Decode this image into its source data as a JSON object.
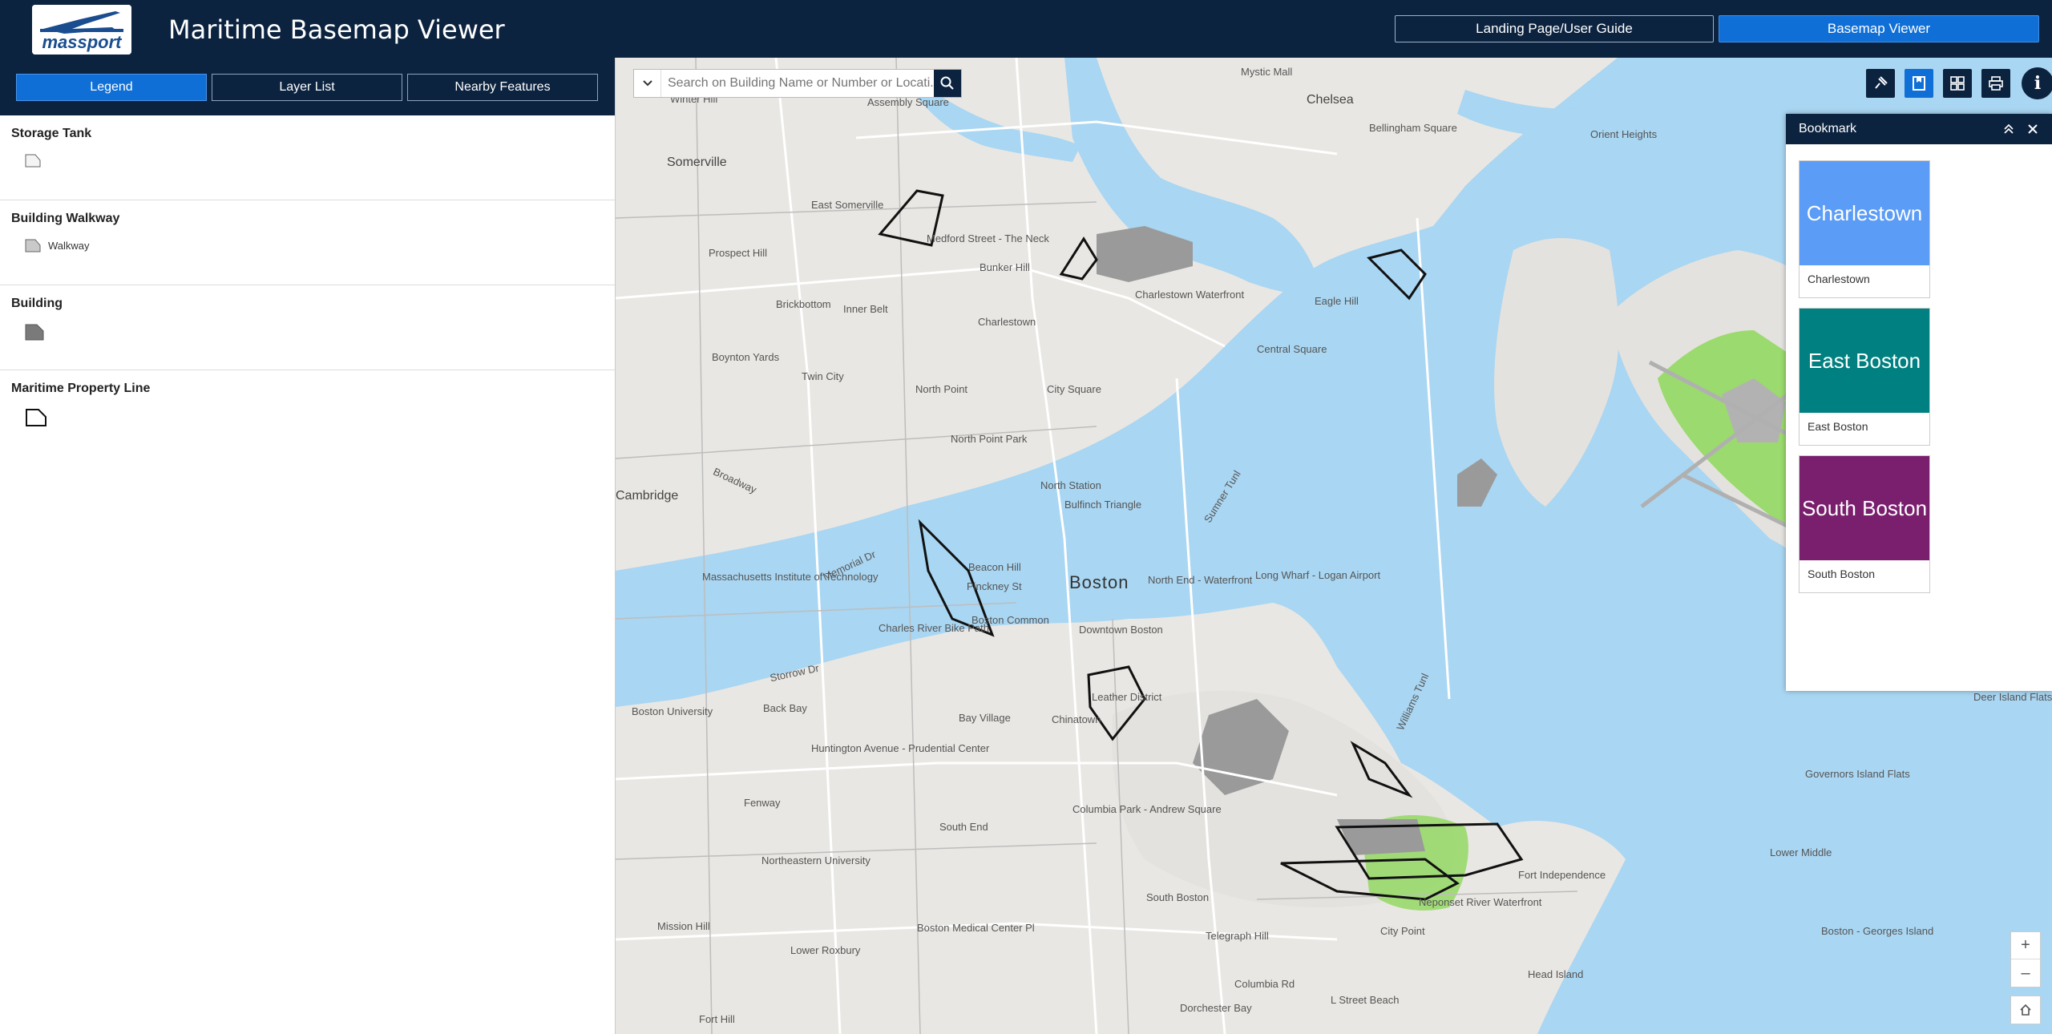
{
  "header": {
    "logo_text": "massport",
    "title": "Maritime Basemap Viewer",
    "buttons": [
      {
        "label": "Landing Page/User Guide"
      },
      {
        "label": "Basemap Viewer"
      }
    ]
  },
  "panel": {
    "tabs": [
      {
        "label": "Legend"
      },
      {
        "label": "Layer List"
      },
      {
        "label": "Nearby Features"
      }
    ],
    "legend": [
      {
        "title": "Storage Tank",
        "items": [
          {
            "label": ""
          }
        ]
      },
      {
        "title": "Building Walkway",
        "items": [
          {
            "label": "Walkway"
          }
        ]
      },
      {
        "title": "Building",
        "items": [
          {
            "label": ""
          }
        ]
      },
      {
        "title": "Maritime Property Line",
        "items": [
          {
            "label": ""
          }
        ]
      }
    ]
  },
  "search": {
    "placeholder": "Search on Building Name or Number or Locati..."
  },
  "bookmark": {
    "title": "Bookmark",
    "items": [
      {
        "thumb_label": "Charlestown",
        "name": "Charlestown",
        "color": "#5b9cf6"
      },
      {
        "thumb_label": "East Boston",
        "name": "East Boston",
        "color": "#008080"
      },
      {
        "thumb_label": "South Boston",
        "name": "South Boston",
        "color": "#7a1f6e"
      }
    ]
  },
  "map": {
    "labels": [
      "Somerville",
      "Chelsea",
      "East Somerville",
      "Prospect Hill",
      "Brickbottom",
      "Inner Belt",
      "Charlestown",
      "Bunker Hill",
      "Medford Street - The Neck",
      "Charlestown Waterfront",
      "Boynton Yards",
      "Twin City",
      "North Point",
      "City Square",
      "North Point Park",
      "Cambridge",
      "Massachusetts Institute of Technology",
      "Beacon Hill",
      "Boston",
      "North Station",
      "Bulfinch Triangle",
      "North End - Waterfront",
      "Boston Common",
      "Downtown Boston",
      "Back Bay",
      "Bay Village",
      "Chinatown",
      "Leather District",
      "Huntington Avenue - Prudential Center",
      "Fenway",
      "South End",
      "Columbia Park - Andrew Square",
      "South Boston",
      "City Point",
      "Telegraph Hill",
      "Dorchester Bay",
      "Mission Hill",
      "Lower Roxbury",
      "Fort Hill",
      "Central Square",
      "Eagle Hill",
      "Orient Heights",
      "Mystic Mall",
      "Governors Island Flats",
      "Lower Middle",
      "Deer Island Flats",
      "Head Island",
      "Boston University",
      "Bellingham Square",
      "Sumner Tunl",
      "Williams Tunl",
      "Charles River Bike Path",
      "Long Wharf - Logan Airport",
      "Boston - Georges Island",
      "Northeastern University",
      "Boston Medical Center Pl",
      "Assembly Square",
      "Winter Hill",
      "Pinckney St",
      "Broadway",
      "Memorial Dr",
      "Storrow Dr",
      "Fort Independence",
      "Neponset River Waterfront",
      "L Street Beach",
      "Columbia Rd"
    ],
    "zoom_in": "+",
    "zoom_out": "–"
  },
  "icons": {
    "search": "search-icon",
    "info": "info-icon",
    "collapse": "chevron-double-up-icon",
    "close": "close-icon",
    "home": "home-icon"
  }
}
